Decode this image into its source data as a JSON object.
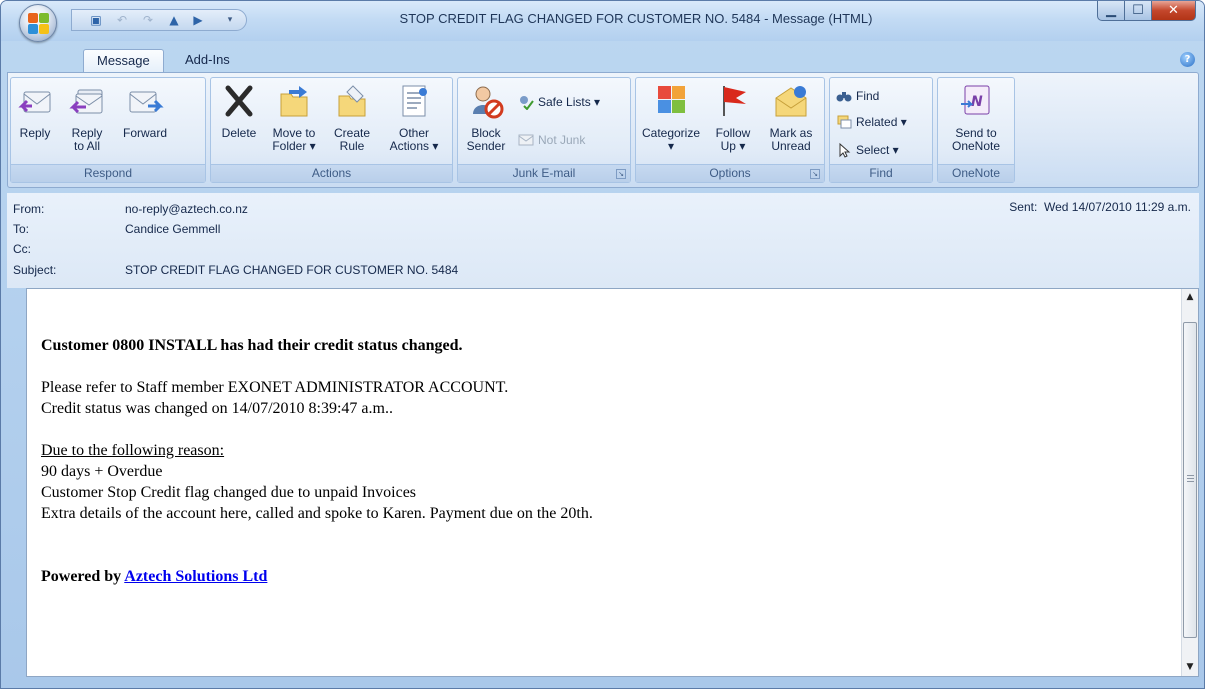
{
  "window": {
    "title": "STOP CREDIT FLAG CHANGED FOR CUSTOMER NO. 5484 - Message (HTML)"
  },
  "tabs": [
    {
      "label": "Message",
      "active": true
    },
    {
      "label": "Add-Ins",
      "active": false
    }
  ],
  "ribbon": {
    "respond": {
      "label": "Respond",
      "reply": "Reply",
      "reply_all": "Reply\nto All",
      "forward": "Forward"
    },
    "actions": {
      "label": "Actions",
      "delete": "Delete",
      "move_to_folder": "Move to\nFolder ▾",
      "create_rule": "Create\nRule",
      "other_actions": "Other\nActions ▾"
    },
    "junk": {
      "label": "Junk E-mail",
      "block_sender": "Block\nSender",
      "safe_lists": "Safe Lists ▾",
      "not_junk": "Not Junk"
    },
    "options": {
      "label": "Options",
      "categorize": "Categorize\n▾",
      "follow_up": "Follow\nUp ▾",
      "mark_unread": "Mark as\nUnread"
    },
    "find": {
      "label": "Find",
      "find": "Find",
      "related": "Related ▾",
      "select": "Select ▾"
    },
    "onenote": {
      "label": "OneNote",
      "send_to_onenote": "Send to\nOneNote"
    }
  },
  "header": {
    "from_label": "From:",
    "from_value": "no-reply@aztech.co.nz",
    "to_label": "To:",
    "to_value": "Candice Gemmell",
    "cc_label": "Cc:",
    "cc_value": "",
    "subject_label": "Subject:",
    "subject_value": "STOP CREDIT FLAG CHANGED FOR CUSTOMER NO. 5484",
    "sent_label": "Sent:",
    "sent_value": "Wed 14/07/2010 11:29 a.m."
  },
  "body": {
    "headline": "Customer 0800 INSTALL has had their credit status changed.",
    "line1": "Please refer to Staff member EXONET ADMINISTRATOR ACCOUNT.",
    "line2": "Credit status was changed on 14/07/2010 8:39:47 a.m..",
    "reason_heading": "Due to the following reason:",
    "reason1": "90 days + Overdue",
    "reason2": "Customer Stop Credit flag changed due to unpaid Invoices",
    "reason3": "Extra details of the account here, called and spoke to Karen. Payment due on the 20th.",
    "powered_prefix": "Powered by ",
    "powered_link": "Aztech Solutions Ltd"
  },
  "colors": {
    "ribbon_bg": "#dbe7f6",
    "link": "#0000ee",
    "close_button": "#c4472c"
  }
}
